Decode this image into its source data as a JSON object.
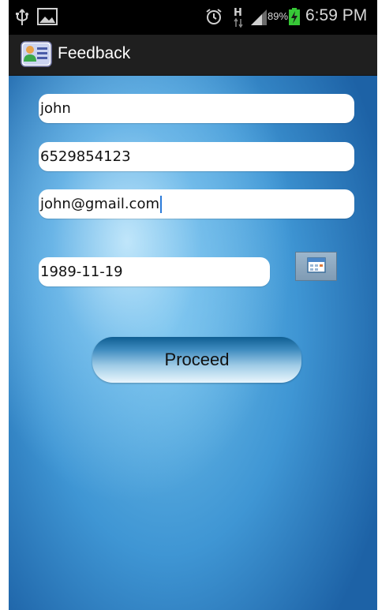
{
  "status_bar": {
    "battery_percent": "89%",
    "time": "6:59 PM",
    "network_type": "H",
    "icons": [
      "usb-icon",
      "image-icon",
      "alarm-icon",
      "hspa-icon",
      "signal-icon",
      "battery-charging-icon"
    ]
  },
  "action_bar": {
    "title": "Feedback",
    "icon": "contact-card-icon"
  },
  "form": {
    "name_value": "john",
    "phone_value": "6529854123",
    "email_value": "john@gmail.com",
    "date_value": "1989-11-19",
    "calendar_icon": "calendar-icon",
    "proceed_label": "Proceed"
  },
  "colors": {
    "status_bar_bg": "#000000",
    "action_bar_bg": "#1f1f1f",
    "battery_charging": "#37c837",
    "accent_blue": "#2b7bd9"
  }
}
